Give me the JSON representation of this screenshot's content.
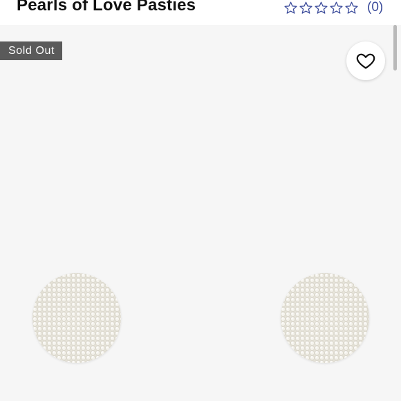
{
  "product": {
    "title": "Pearls of Love Pasties",
    "rating": {
      "stars_filled": 0,
      "stars_total": 5,
      "review_count_label": "(0)",
      "star_color": "#3a4a9a"
    }
  },
  "badge": {
    "label": "Sold Out",
    "background": "#5a5a5a"
  },
  "like_button": {
    "icon": "heart-outline-icon"
  },
  "image": {
    "items": [
      "pearl-pasty",
      "pearl-pasty"
    ],
    "background": "#f6f6f6"
  }
}
